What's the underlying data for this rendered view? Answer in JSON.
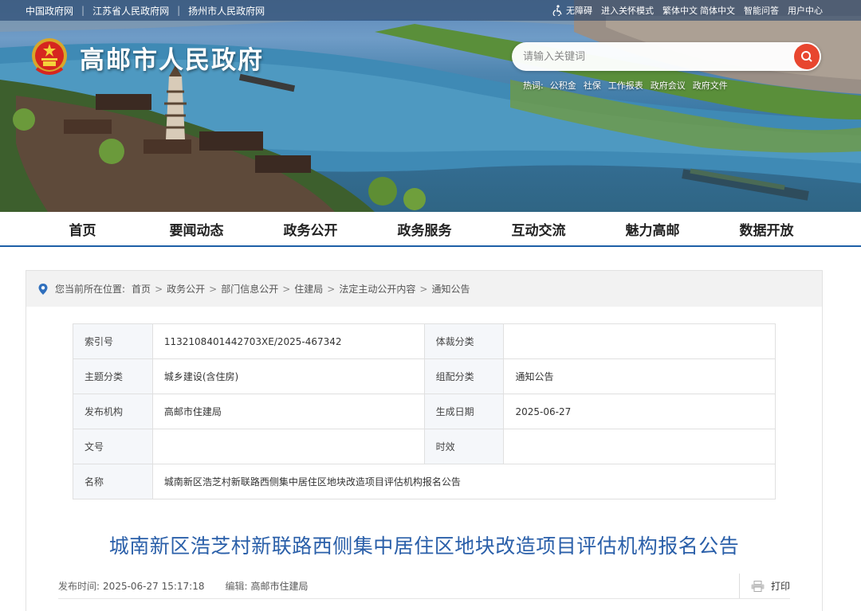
{
  "top_links": [
    "中国政府网",
    "江苏省人民政府网",
    "扬州市人民政府网"
  ],
  "top_tools": [
    "无障碍",
    "进入关怀模式",
    "繁体中文",
    "简体中文",
    "智能问答",
    "用户中心"
  ],
  "site_title": "高邮市人民政府",
  "search": {
    "placeholder": "请输入关键词"
  },
  "hot": {
    "label": "热词:",
    "words": [
      "公积金",
      "社保",
      "工作报表",
      "政府会议",
      "政府文件"
    ]
  },
  "nav": [
    "首页",
    "要闻动态",
    "政务公开",
    "政务服务",
    "互动交流",
    "魅力高邮",
    "数据开放"
  ],
  "breadcrumb": {
    "label": "您当前所在位置:",
    "items": [
      "首页",
      "政务公开",
      "部门信息公开",
      "住建局",
      "法定主动公开内容",
      "通知公告"
    ]
  },
  "info_table": {
    "index_no_label": "索引号",
    "index_no": "1132108401442703XE/2025-467342",
    "genre_label": "体裁分类",
    "genre": "",
    "topic_label": "主题分类",
    "topic": "城乡建设(含住房)",
    "group_label": "组配分类",
    "group": "通知公告",
    "publisher_label": "发布机构",
    "publisher": "高邮市住建局",
    "date_label": "生成日期",
    "date": "2025-06-27",
    "doc_no_label": "文号",
    "doc_no": "",
    "validity_label": "时效",
    "validity": "",
    "name_label": "名称",
    "name": "城南新区浩芝村新联路西侧集中居住区地块改造项目评估机构报名公告"
  },
  "article": {
    "title": "城南新区浩芝村新联路西侧集中居住区地块改造项目评估机构报名公告",
    "publish_label": "发布时间:",
    "publish_time": "2025-06-27 15:17:18",
    "editor_label": "编辑:",
    "editor": "高邮市住建局",
    "print_label": "打印"
  },
  "colors": {
    "nav_border": "#1e5fa7",
    "title_blue": "#2a5fa9",
    "search_button": "#e8462f"
  }
}
